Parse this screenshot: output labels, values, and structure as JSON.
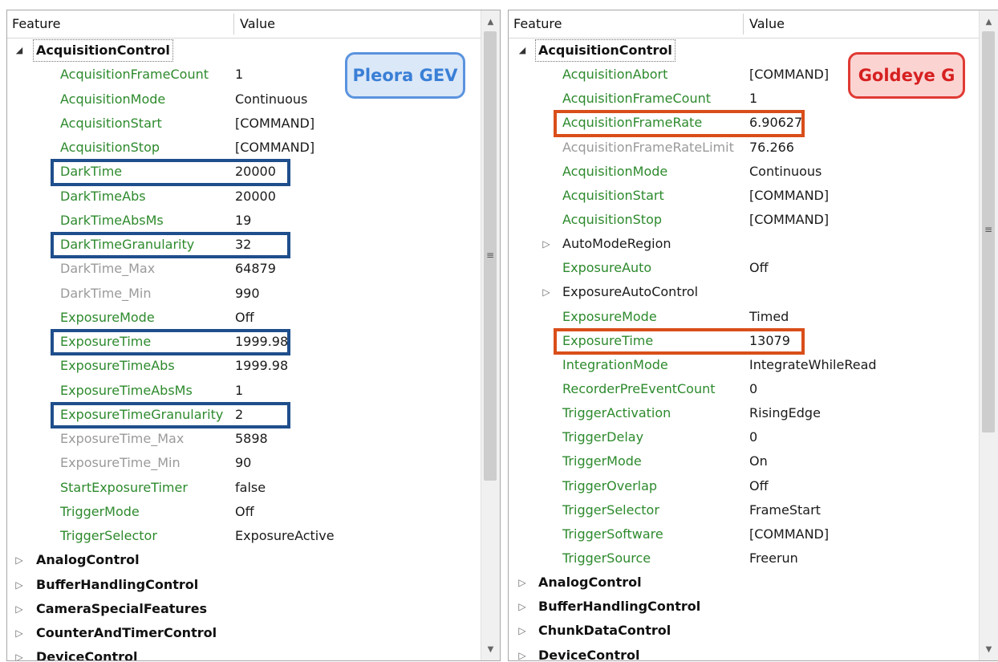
{
  "header": {
    "feature_label": "Feature",
    "value_label": "Value"
  },
  "left_panel": {
    "badge": "Pleora GEV",
    "rows": [
      {
        "indent": 0,
        "expander": "open",
        "style": "cat",
        "selected": true,
        "label": "AcquisitionControl",
        "value": ""
      },
      {
        "indent": 1,
        "expander": "",
        "style": "green",
        "label": "AcquisitionFrameCount",
        "value": "1"
      },
      {
        "indent": 1,
        "expander": "",
        "style": "green",
        "label": "AcquisitionMode",
        "value": "Continuous"
      },
      {
        "indent": 1,
        "expander": "",
        "style": "green",
        "label": "AcquisitionStart",
        "value": "[COMMAND]"
      },
      {
        "indent": 1,
        "expander": "",
        "style": "green",
        "label": "AcquisitionStop",
        "value": "[COMMAND]"
      },
      {
        "indent": 1,
        "expander": "",
        "style": "green",
        "label": "DarkTime",
        "value": "20000",
        "highlight": true
      },
      {
        "indent": 1,
        "expander": "",
        "style": "green",
        "label": "DarkTimeAbs",
        "value": "20000"
      },
      {
        "indent": 1,
        "expander": "",
        "style": "green",
        "label": "DarkTimeAbsMs",
        "value": "19"
      },
      {
        "indent": 1,
        "expander": "",
        "style": "green",
        "label": "DarkTimeGranularity",
        "value": "32",
        "highlight": true
      },
      {
        "indent": 1,
        "expander": "",
        "style": "gray",
        "label": "DarkTime_Max",
        "value": "64879"
      },
      {
        "indent": 1,
        "expander": "",
        "style": "gray",
        "label": "DarkTime_Min",
        "value": "990"
      },
      {
        "indent": 1,
        "expander": "",
        "style": "green",
        "label": "ExposureMode",
        "value": "Off"
      },
      {
        "indent": 1,
        "expander": "",
        "style": "green",
        "label": "ExposureTime",
        "value": "1999.98",
        "highlight": true
      },
      {
        "indent": 1,
        "expander": "",
        "style": "green",
        "label": "ExposureTimeAbs",
        "value": "1999.98"
      },
      {
        "indent": 1,
        "expander": "",
        "style": "green",
        "label": "ExposureTimeAbsMs",
        "value": "1"
      },
      {
        "indent": 1,
        "expander": "",
        "style": "green",
        "label": "ExposureTimeGranularity",
        "value": "2",
        "highlight": true
      },
      {
        "indent": 1,
        "expander": "",
        "style": "gray",
        "label": "ExposureTime_Max",
        "value": "5898"
      },
      {
        "indent": 1,
        "expander": "",
        "style": "gray",
        "label": "ExposureTime_Min",
        "value": "90"
      },
      {
        "indent": 1,
        "expander": "",
        "style": "green",
        "label": "StartExposureTimer",
        "value": "false"
      },
      {
        "indent": 1,
        "expander": "",
        "style": "green",
        "label": "TriggerMode",
        "value": "Off"
      },
      {
        "indent": 1,
        "expander": "",
        "style": "green",
        "label": "TriggerSelector",
        "value": "ExposureActive"
      },
      {
        "indent": 0,
        "expander": "closed",
        "style": "cat",
        "label": "AnalogControl",
        "value": ""
      },
      {
        "indent": 0,
        "expander": "closed",
        "style": "cat",
        "label": "BufferHandlingControl",
        "value": ""
      },
      {
        "indent": 0,
        "expander": "closed",
        "style": "cat",
        "label": "CameraSpecialFeatures",
        "value": ""
      },
      {
        "indent": 0,
        "expander": "closed",
        "style": "cat",
        "label": "CounterAndTimerControl",
        "value": ""
      },
      {
        "indent": 0,
        "expander": "closed",
        "style": "cat",
        "label": "DeviceControl",
        "value": ""
      }
    ]
  },
  "right_panel": {
    "badge": "Goldeye G",
    "rows": [
      {
        "indent": 0,
        "expander": "open",
        "style": "cat",
        "selected": true,
        "label": "AcquisitionControl",
        "value": ""
      },
      {
        "indent": 1,
        "expander": "",
        "style": "green",
        "label": "AcquisitionAbort",
        "value": "[COMMAND]"
      },
      {
        "indent": 1,
        "expander": "",
        "style": "green",
        "label": "AcquisitionFrameCount",
        "value": "1"
      },
      {
        "indent": 1,
        "expander": "",
        "style": "green",
        "label": "AcquisitionFrameRate",
        "value": "6.90627",
        "highlight": true
      },
      {
        "indent": 1,
        "expander": "",
        "style": "gray",
        "label": "AcquisitionFrameRateLimit",
        "value": "76.266"
      },
      {
        "indent": 1,
        "expander": "",
        "style": "green",
        "label": "AcquisitionMode",
        "value": "Continuous"
      },
      {
        "indent": 1,
        "expander": "",
        "style": "green",
        "label": "AcquisitionStart",
        "value": "[COMMAND]"
      },
      {
        "indent": 1,
        "expander": "",
        "style": "green",
        "label": "AcquisitionStop",
        "value": "[COMMAND]"
      },
      {
        "indent": 1,
        "expander": "closed",
        "style": "black",
        "label": "AutoModeRegion",
        "value": ""
      },
      {
        "indent": 1,
        "expander": "",
        "style": "green",
        "label": "ExposureAuto",
        "value": "Off"
      },
      {
        "indent": 1,
        "expander": "closed",
        "style": "black",
        "label": "ExposureAutoControl",
        "value": ""
      },
      {
        "indent": 1,
        "expander": "",
        "style": "green",
        "label": "ExposureMode",
        "value": "Timed"
      },
      {
        "indent": 1,
        "expander": "",
        "style": "green",
        "label": "ExposureTime",
        "value": "13079",
        "highlight": true
      },
      {
        "indent": 1,
        "expander": "",
        "style": "green",
        "label": "IntegrationMode",
        "value": "IntegrateWhileRead"
      },
      {
        "indent": 1,
        "expander": "",
        "style": "green",
        "label": "RecorderPreEventCount",
        "value": "0"
      },
      {
        "indent": 1,
        "expander": "",
        "style": "green",
        "label": "TriggerActivation",
        "value": "RisingEdge"
      },
      {
        "indent": 1,
        "expander": "",
        "style": "green",
        "label": "TriggerDelay",
        "value": "0"
      },
      {
        "indent": 1,
        "expander": "",
        "style": "green",
        "label": "TriggerMode",
        "value": "On"
      },
      {
        "indent": 1,
        "expander": "",
        "style": "green",
        "label": "TriggerOverlap",
        "value": "Off"
      },
      {
        "indent": 1,
        "expander": "",
        "style": "green",
        "label": "TriggerSelector",
        "value": "FrameStart"
      },
      {
        "indent": 1,
        "expander": "",
        "style": "green",
        "label": "TriggerSoftware",
        "value": "[COMMAND]"
      },
      {
        "indent": 1,
        "expander": "",
        "style": "green",
        "label": "TriggerSource",
        "value": "Freerun"
      },
      {
        "indent": 0,
        "expander": "closed",
        "style": "cat",
        "label": "AnalogControl",
        "value": ""
      },
      {
        "indent": 0,
        "expander": "closed",
        "style": "cat",
        "label": "BufferHandlingControl",
        "value": ""
      },
      {
        "indent": 0,
        "expander": "closed",
        "style": "cat",
        "label": "ChunkDataControl",
        "value": ""
      },
      {
        "indent": 0,
        "expander": "closed",
        "style": "cat",
        "label": "DeviceControl",
        "value": ""
      }
    ]
  },
  "icons": {
    "expanded": "triangle-down-icon",
    "collapsed": "triangle-right-icon",
    "scroll_up": "arrow-up-icon",
    "scroll_down": "arrow-down-icon",
    "grip": "scroll-grip-icon"
  },
  "colors": {
    "feature_green": "#2d8a2d",
    "feature_gray": "#9a9a9a",
    "highlight_blue": "#1f4e8c",
    "highlight_orange": "#d94e1a"
  }
}
